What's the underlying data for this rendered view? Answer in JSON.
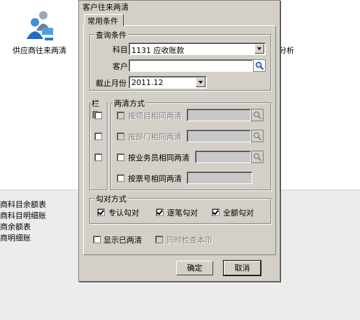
{
  "background": {
    "desktop_icon_label": "供应商往来两清",
    "right_partial_label": "分析",
    "report_list": [
      "商科目余额表",
      "商科目明细账",
      "商余额表",
      "商明细账"
    ]
  },
  "dialog": {
    "title": "客户往来两清",
    "tab": "常用条件",
    "query": {
      "group_title": "查询条件",
      "subject_label": "科目",
      "subject_value": "1131 应收账款",
      "customer_label": "客户",
      "customer_value": "",
      "month_label": "截止月份",
      "month_value": "2011.12"
    },
    "column_group_title": "栏目",
    "method": {
      "group_title": "两清方式",
      "options": [
        {
          "label": "按项目相同两清",
          "enabled": false
        },
        {
          "label": "按部门相同两清",
          "enabled": false
        },
        {
          "label": "按业务员相同两清",
          "enabled": true
        },
        {
          "label": "按票号相同两清",
          "enabled": true
        }
      ]
    },
    "check_mode": {
      "group_title": "勾对方式",
      "options": [
        {
          "label": "专认勾对",
          "checked": true
        },
        {
          "label": "逐笔勾对",
          "checked": true
        },
        {
          "label": "全额勾对",
          "checked": true
        }
      ]
    },
    "show_cleared_label": "显示已两清",
    "check_base_currency_label": "同时检查本币",
    "ok_label": "确定",
    "cancel_label": "取消"
  },
  "colors": {
    "dialog_bg": "#d4d0c8",
    "disabled_field": "#c8c8c8",
    "background_lower": "#ececec"
  }
}
